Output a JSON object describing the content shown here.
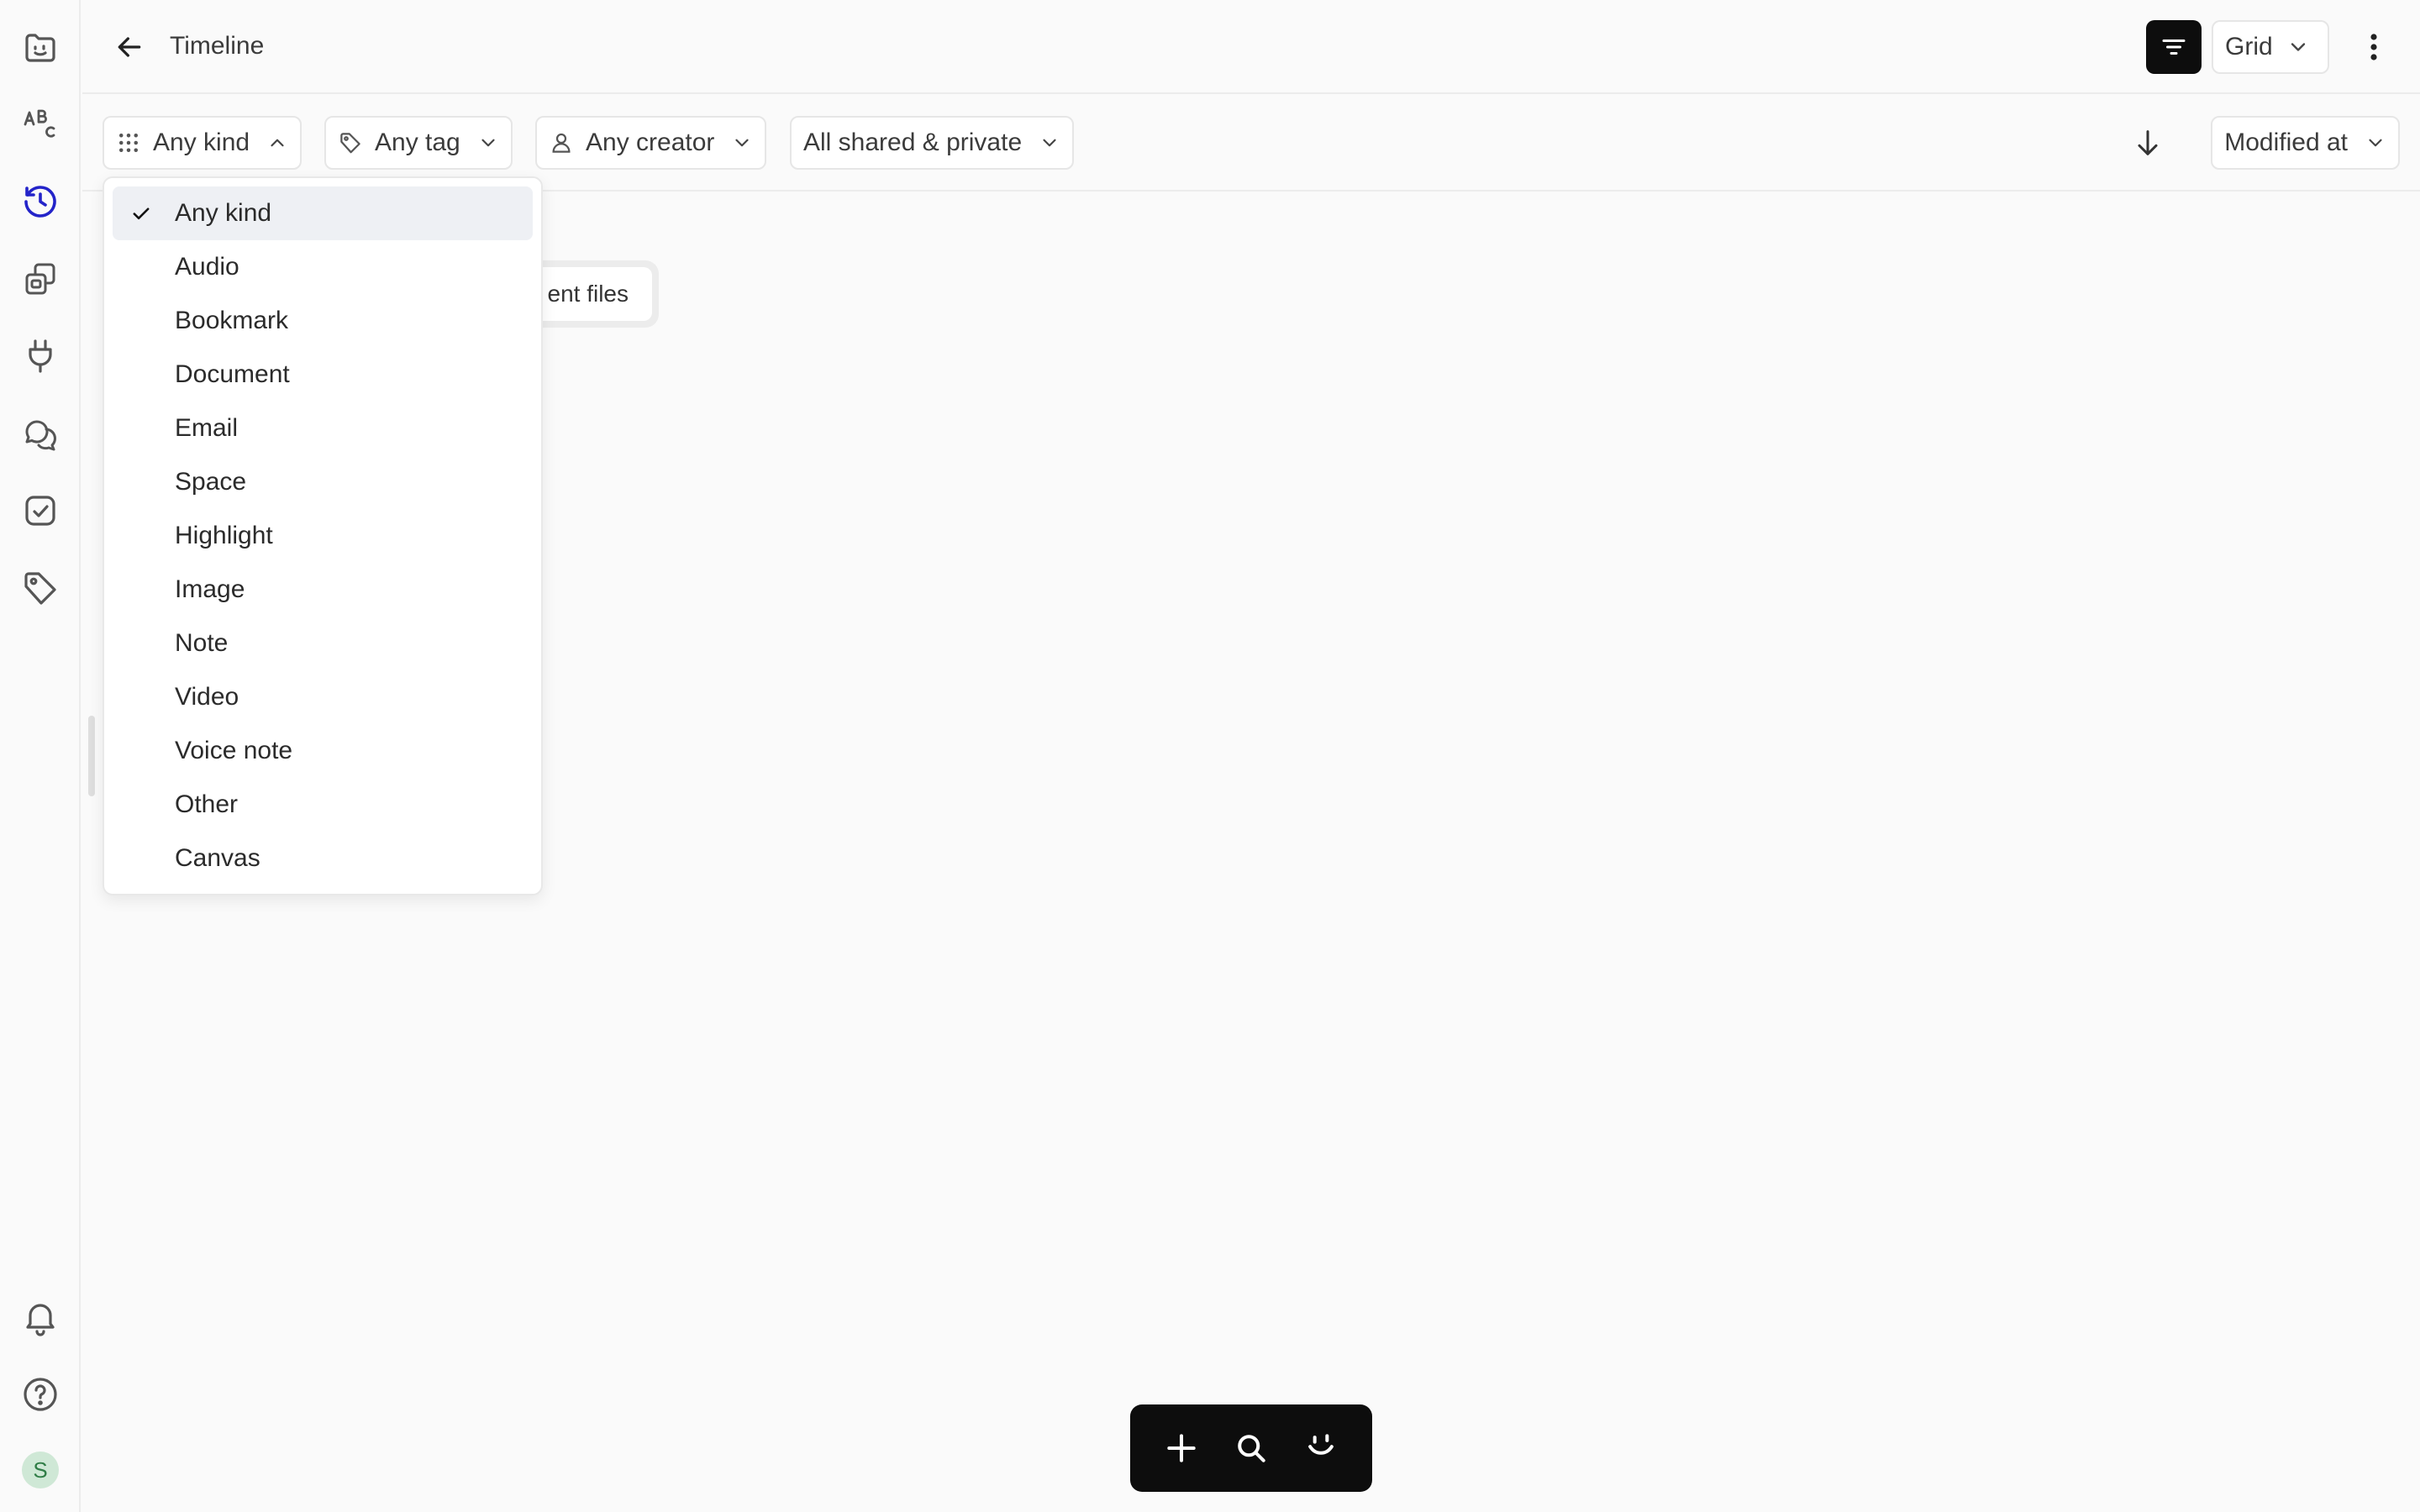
{
  "header": {
    "title": "Timeline",
    "view_mode": "Grid"
  },
  "filters": {
    "kind": "Any kind",
    "tag": "Any tag",
    "creator": "Any creator",
    "visibility": "All shared & private",
    "sort_by": "Modified at"
  },
  "content": {
    "recent_label": "ent files"
  },
  "kind_menu": {
    "selected": "Any kind",
    "items": [
      "Any kind",
      "Audio",
      "Bookmark",
      "Document",
      "Email",
      "Space",
      "Highlight",
      "Image",
      "Note",
      "Video",
      "Voice note",
      "Other",
      "Canvas"
    ]
  },
  "user": {
    "initial": "S"
  },
  "colors": {
    "accent": "#2323c9",
    "dock_background": "#0d0d0d",
    "selected_row": "#eef0f4",
    "avatar_background": "#cfe8d6"
  },
  "icons": {
    "rail": [
      "logo-face-icon",
      "spellcheck-icon",
      "timeline-clock-icon",
      "spaces-icon",
      "plug-icon",
      "chat-icon",
      "tasks-check-icon",
      "tag-icon",
      "bell-icon",
      "help-icon"
    ],
    "dock": [
      "plus-icon",
      "search-icon",
      "assistant-face-icon"
    ]
  }
}
